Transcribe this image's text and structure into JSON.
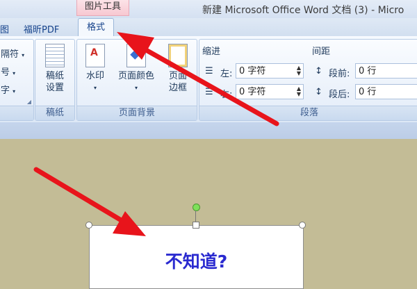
{
  "title_bar": {
    "context_tab": "图片工具",
    "document_title": "新建 Microsoft Office Word 文档 (3) - Micro"
  },
  "tabs": {
    "left_partial": "图",
    "foxit_pdf": "福昕PDF",
    "format": "格式"
  },
  "ribbon": {
    "left_group": {
      "items": [
        "隔符",
        "号",
        "字"
      ]
    },
    "manuscript_group": {
      "button_line1": "稿纸",
      "button_line2": "设置",
      "label": "稿纸"
    },
    "page_background_group": {
      "watermark": "水印",
      "page_color": "页面颜色",
      "page_border_line1": "页面",
      "page_border_line2": "边框",
      "label": "页面背景"
    },
    "paragraph_group": {
      "indent_label": "缩进",
      "spacing_label": "间距",
      "indent_left_label": "左:",
      "indent_left_value": "0 字符",
      "indent_right_label": "右:",
      "indent_right_value": "0 字符",
      "spacing_before_label": "段前:",
      "spacing_before_value": "0 行",
      "spacing_after_label": "段后:",
      "spacing_after_value": "0 行",
      "label": "段落"
    }
  },
  "document": {
    "textbox_text": "不知道?"
  },
  "colors": {
    "annotation_arrow": "#e8141b",
    "textbox_text": "#2a2ad0",
    "workspace": "#c3bc96"
  }
}
